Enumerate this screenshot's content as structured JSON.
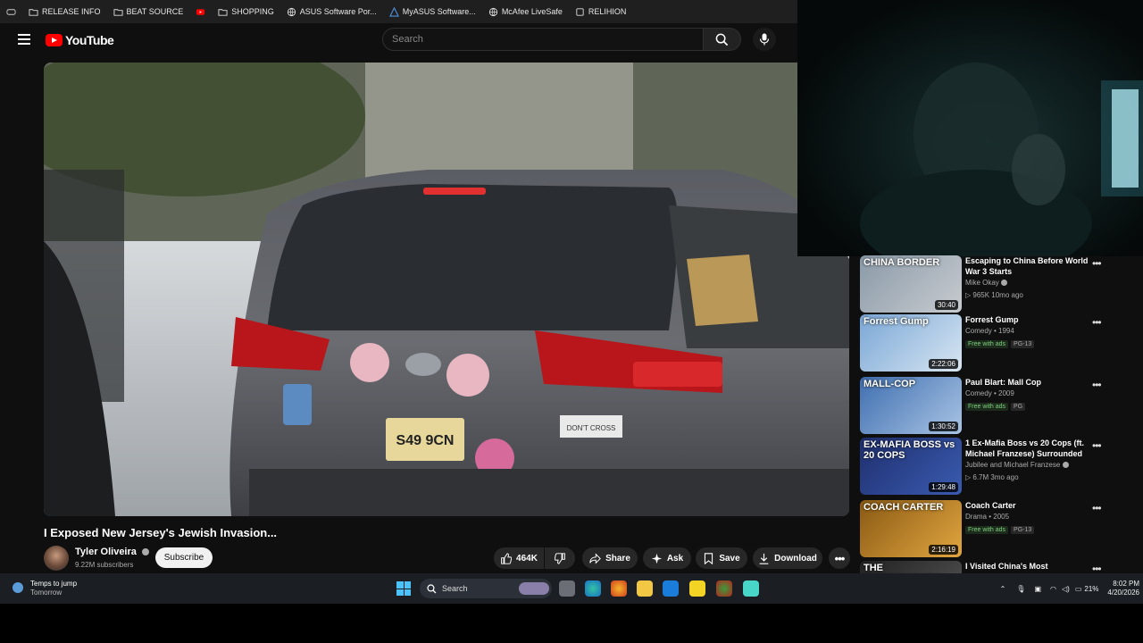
{
  "bookmarks": [
    {
      "label": "RELEASE INFO",
      "icon": "folder-icon"
    },
    {
      "label": "BEAT SOURCE",
      "icon": "folder-icon"
    },
    {
      "label": "",
      "icon": "youtube-favicon"
    },
    {
      "label": "SHOPPING",
      "icon": "folder-icon"
    },
    {
      "label": "ASUS Software Por...",
      "icon": "globe-icon"
    },
    {
      "label": "MyASUS Software...",
      "icon": "asus-icon"
    },
    {
      "label": "McAfee LiveSafe",
      "icon": "globe-icon"
    },
    {
      "label": "RELIHION",
      "icon": "page-icon"
    }
  ],
  "header": {
    "logo_text": "YouTube",
    "search_placeholder": "Search"
  },
  "video": {
    "title": "I Exposed New Jersey's Jewish Invasion...",
    "channel": "Tyler Oliveira",
    "subscribers": "9.22M subscribers",
    "subscribe_label": "Subscribe",
    "likes": "464K",
    "share_label": "Share",
    "ask_label": "Ask",
    "save_label": "Save",
    "download_label": "Download",
    "plate_text": "S49 9CN",
    "sticker_text": "DON'T CROSS"
  },
  "recommendations": [
    {
      "title": "Escaping to China Before World War 3 Starts",
      "channel": "Mike Okay",
      "verified": true,
      "stats": "▷ 965K  10mo ago",
      "duration": "30:40",
      "thumb_caption": "CHINA BORDER",
      "thumb_colors": [
        "#8a9aa8",
        "#c8cbd0"
      ]
    },
    {
      "title": "Forrest Gump",
      "channel": "Comedy • 1994",
      "badges": [
        "Free with ads",
        "PG-13"
      ],
      "duration": "2:22:06",
      "thumb_caption": "Forrest Gump",
      "thumb_colors": [
        "#7aa7d6",
        "#d8e6f2"
      ]
    },
    {
      "title": "Paul Blart: Mall Cop",
      "channel": "Comedy • 2009",
      "badges": [
        "Free with ads",
        "PG"
      ],
      "duration": "1:30:52",
      "thumb_caption": "MALL-COP",
      "thumb_colors": [
        "#3f6fb0",
        "#a9c4e4"
      ]
    },
    {
      "title": "1 Ex-Mafia Boss vs 20 Cops (ft. Michael Franzese) Surrounded",
      "channel": "Jubilee  and Michael Franzese",
      "verified": true,
      "stats": "▷ 6.7M  3mo ago",
      "duration": "1:29:48",
      "thumb_caption": "EX-MAFIA BOSS vs 20 COPS",
      "thumb_colors": [
        "#1f2f6e",
        "#3a5bb0"
      ]
    },
    {
      "title": "Coach Carter",
      "channel": "Drama • 2005",
      "badges": [
        "Free with ads",
        "PG-13"
      ],
      "duration": "2:16:19",
      "thumb_caption": "COACH CARTER",
      "thumb_colors": [
        "#8a5a14",
        "#e2a640"
      ]
    },
    {
      "title": "I Visited China's Most",
      "channel": "",
      "thumb_caption": "THE SURVEILLANCE STATE",
      "thumb_colors": [
        "#222",
        "#555"
      ]
    }
  ],
  "taskbar": {
    "weather_title": "Temps to jump",
    "weather_sub": "Tomorrow",
    "search_label": "Search",
    "battery": "21%",
    "time": "8:02 PM",
    "date": "4/20/2026"
  }
}
